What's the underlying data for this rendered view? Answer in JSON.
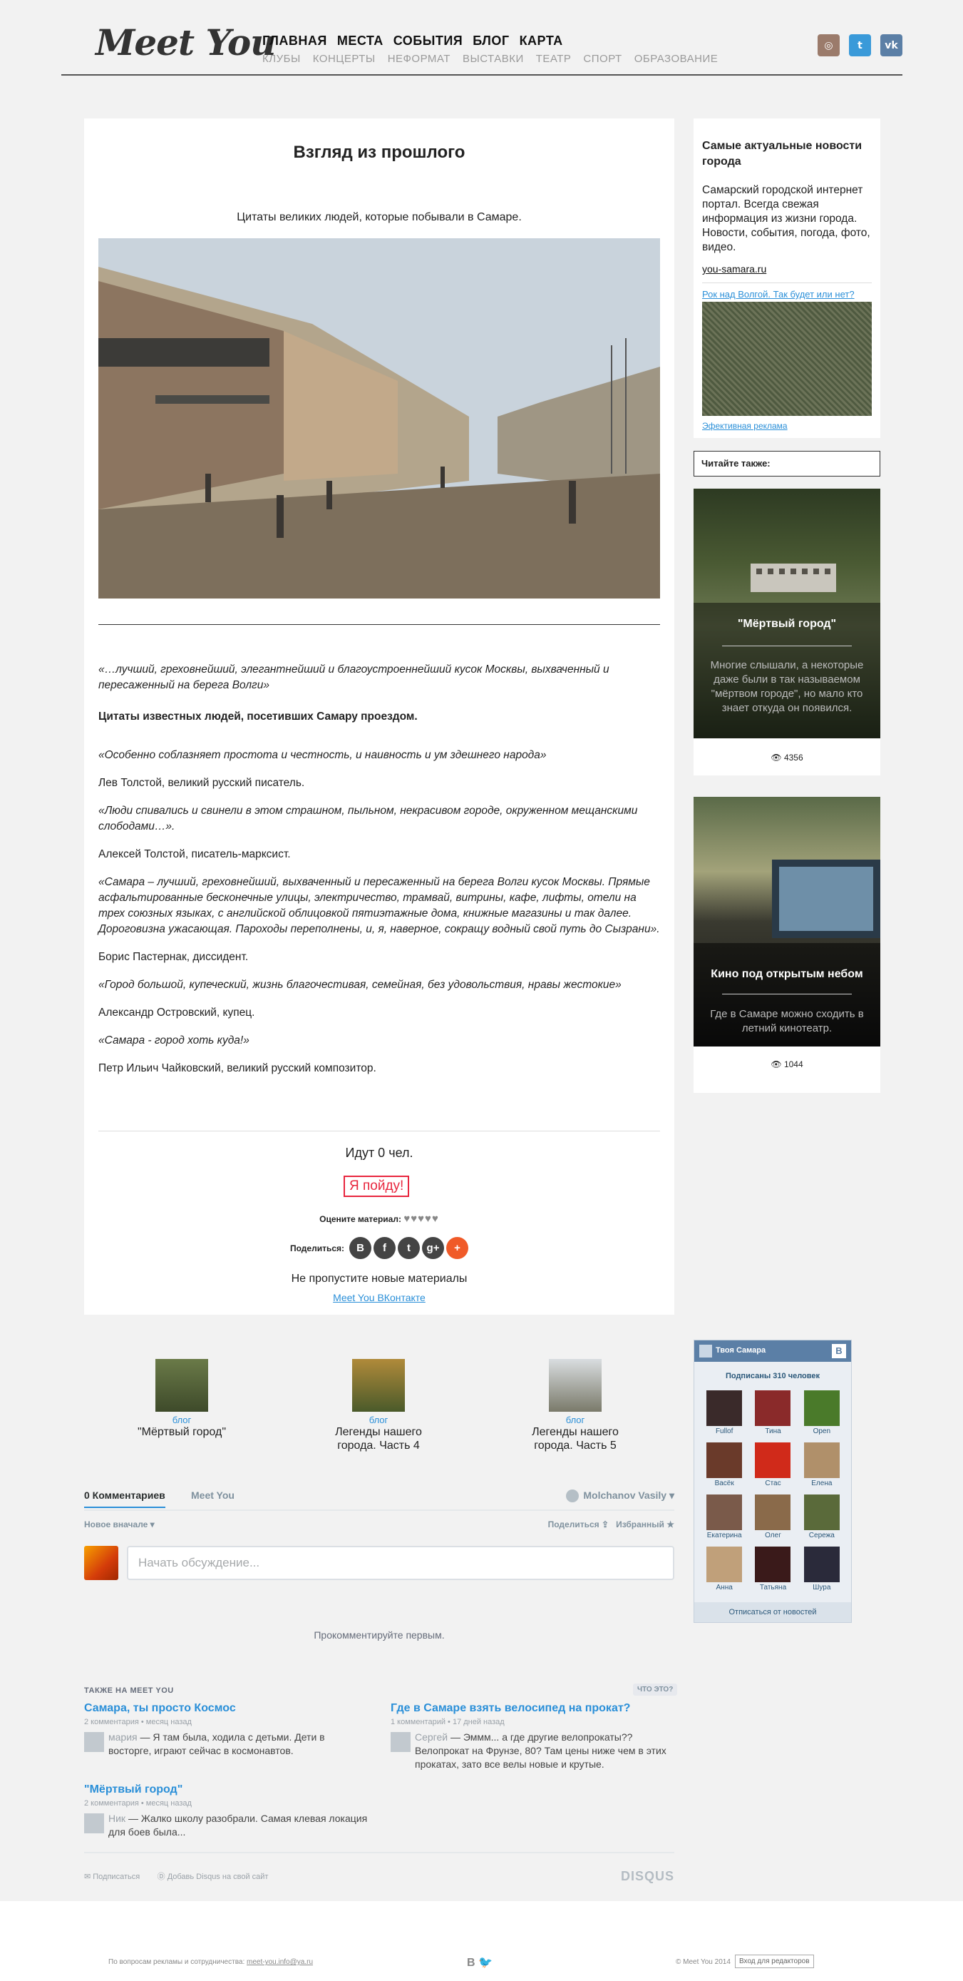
{
  "header": {
    "logo": "Meet You",
    "nav_main": [
      "ГЛАВНАЯ",
      "МЕСТА",
      "СОБЫТИЯ",
      "БЛОГ",
      "КАРТА"
    ],
    "nav_sub": [
      "КЛУБЫ",
      "КОНЦЕРТЫ",
      "НЕФОРМАТ",
      "ВЫСТАВКИ",
      "ТЕАТР",
      "СПОРТ",
      "ОБРАЗОВАНИЕ"
    ],
    "socials": [
      {
        "name": "instagram-icon",
        "color": "#9b7b6b",
        "glyph": "◎"
      },
      {
        "name": "twitter-icon",
        "color": "#3a9ad9",
        "glyph": "t"
      },
      {
        "name": "vk-icon",
        "color": "#5b7fa6",
        "glyph": "vk"
      }
    ]
  },
  "article": {
    "title": "Взгляд из прошлого",
    "intro": "Цитаты великих людей, которые побывали в Самаре.",
    "paragraphs": [
      {
        "text": "«…лучший, греховнейший, элегантнейший и благоустроеннейший кусок Москвы, выхваченный и пересаженный на берега Волги»",
        "style": "q"
      },
      {
        "text": "Цитаты известных людей, посетивших Самару проездом.",
        "style": "b"
      },
      {
        "text": "«Особенно соблазняет простота и честность, и наивность и ум здешнего народа»",
        "style": "q"
      },
      {
        "text": "Лев Толстой, великий русский писатель.",
        "style": ""
      },
      {
        "text": "«Люди спивались и свинели в этом страшном, пыльном, некрасивом городе, окруженном мещанскими слободами…».",
        "style": "q"
      },
      {
        "text": "Алексей Толстой, писатель-марксист.",
        "style": ""
      },
      {
        "text": "«Самара – лучший, греховнейший, выхваченный и пересаженный на берега Волги кусок Москвы. Прямые асфальтированные бесконечные улицы, электричество, трамвай, витрины, кафе, лифты, отели на трех союзных языках, с английской облицовкой пятиэтажные дома, книжные магазины и так далее. Дороговизна ужасающая. Пароходы переполнены, и, я, наверное, сокращу водный свой путь до Сызрани».",
        "style": "q"
      },
      {
        "text": "Борис Пастернак, диссидент.",
        "style": ""
      },
      {
        "text": "«Город большой, купеческий, жизнь благочестивая, семейная, без удовольствия, нравы жестокие»",
        "style": "q"
      },
      {
        "text": "Александр Островский, купец.",
        "style": ""
      },
      {
        "text": "«Самара - город хоть куда!»",
        "style": "q"
      },
      {
        "text": "Петр Ильич Чайковский, великий русский композитор.",
        "style": ""
      }
    ],
    "going": "Идут 0 чел.",
    "go_button": "Я пойду!",
    "rate_label": "Оцените материал:",
    "hearts": "♥♥♥♥♥",
    "share_label": "Поделиться:",
    "share_buttons": [
      {
        "name": "vk-share-icon",
        "glyph": "B",
        "color": "#444"
      },
      {
        "name": "facebook-share-icon",
        "glyph": "f",
        "color": "#444"
      },
      {
        "name": "twitter-share-icon",
        "glyph": "t",
        "color": "#444"
      },
      {
        "name": "googleplus-share-icon",
        "glyph": "g+",
        "color": "#444"
      },
      {
        "name": "more-share-icon",
        "glyph": "+",
        "color": "#f05a28"
      }
    ],
    "dont_miss": "Не пропустите новые материалы",
    "vk_link": "Meet You ВКонтакте"
  },
  "ad": {
    "title": "Самые актуальные новости города",
    "desc": "Самарский городской интернет портал. Всегда свежая информация из жизни города. Новости, события, погода, фото, видео.",
    "url": "you-samara.ru",
    "link": "Рок над Волгой. Так будет или нет?",
    "effective": "Эфективная реклама"
  },
  "read_also": "Читайте также:",
  "cards": [
    {
      "title": "\"Мёртвый город\"",
      "desc": "Многие слышали, а некоторые даже были в так называемом \"мёртвом городе\", но мало кто знает откуда он появился.",
      "views": "4356",
      "colors": [
        "#3a4a2a",
        "#6a7a4a"
      ]
    },
    {
      "title": "Кино под открытым небом",
      "desc": "Где в Самаре можно сходить в летний кинотеатр.",
      "views": "1044",
      "colors": [
        "#5a6a4a",
        "#1a1a18"
      ]
    }
  ],
  "related": [
    {
      "cat": "блог",
      "title": "\"Мёртвый город\""
    },
    {
      "cat": "блог",
      "title": "Легенды нашего города. Часть 4"
    },
    {
      "cat": "блог",
      "title": "Легенды нашего города. Часть 5"
    }
  ],
  "vk_widget": {
    "group": "Твоя Самара",
    "subs": "Подписаны 310 человек",
    "members": [
      "Fullof",
      "Тина",
      "Open",
      "Васёк",
      "Стас",
      "Елена",
      "Екатерина",
      "Олег",
      "Сережа",
      "Анна",
      "Татьяна",
      "Шура"
    ],
    "unsub": "Отписаться от новостей"
  },
  "disqus": {
    "tab_comments": "0 Комментариев",
    "tab_site": "Meet You",
    "user": "Molchanov Vasily",
    "sort": "Новое вначале ▾",
    "share": "Поделиться",
    "favorite": "Избранный ★",
    "placeholder": "Начать обсуждение...",
    "first": "Прокомментируйте первым.",
    "also_on": "ТАКЖЕ НА MEET YOU",
    "what": "ЧТО ЭТО?",
    "items": [
      {
        "title": "Самара, ты просто Космос",
        "meta": "2 комментария • месяц назад",
        "author": "мария",
        "text": "— Я там была, ходила с детьми. Дети в восторге, играют сейчас в космонавтов."
      },
      {
        "title": "Где в Самаре взять велосипед на прокат?",
        "meta": "1 комментарий • 17 дней назад",
        "author": "Сергей",
        "text": "— Эммм... а где другие велопрокаты?? Велопрокат на Фрунзе, 80? Там цены ниже чем в этих прокатах, зато все велы новые и крутые."
      },
      {
        "title": "\"Мёртвый город\"",
        "meta": "2 комментария • месяц назад",
        "author": "Ник",
        "text": "— Жалко школу разобрали. Самая клевая локация для боев была..."
      }
    ],
    "subscribe": "✉ Подписаться",
    "add_disqus": "Ⓓ Добавь Disqus на свой сайт",
    "brand": "DISQUS"
  },
  "footer": {
    "contact_label": "По вопросам рекламы и сотрудничества:",
    "email": "meet-you.info@ya.ru",
    "icons": "B 🐦",
    "copy": "© Meet You 2014",
    "editors": "Вход для редакторов"
  }
}
